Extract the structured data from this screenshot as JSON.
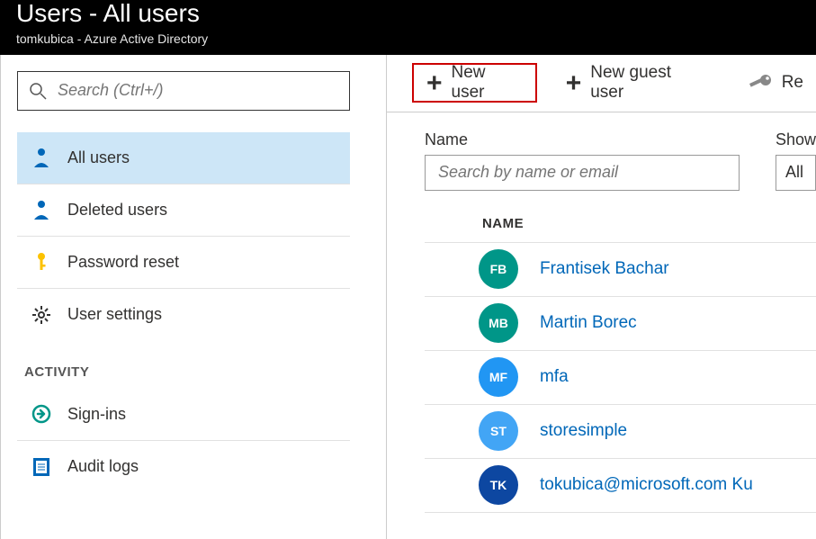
{
  "header": {
    "title": "Users - All users",
    "subtitle": "tomkubica - Azure Active Directory"
  },
  "search": {
    "placeholder": "Search (Ctrl+/)"
  },
  "sidebar": {
    "items": [
      {
        "label": "All users"
      },
      {
        "label": "Deleted users"
      },
      {
        "label": "Password reset"
      },
      {
        "label": "User settings"
      }
    ],
    "activity_heading": "ACTIVITY",
    "activity_items": [
      {
        "label": "Sign-ins"
      },
      {
        "label": "Audit logs"
      }
    ]
  },
  "toolbar": {
    "new_user": "New user",
    "new_guest_user": "New guest user",
    "reset": "Re"
  },
  "filters": {
    "name_label": "Name",
    "name_placeholder": "Search by name or email",
    "show_label": "Show",
    "show_value": "All"
  },
  "table": {
    "col_name": "NAME",
    "rows": [
      {
        "initials": "FB",
        "color": "#009688",
        "name": "Frantisek Bachar"
      },
      {
        "initials": "MB",
        "color": "#009688",
        "name": "Martin Borec"
      },
      {
        "initials": "MF",
        "color": "#2196F3",
        "name": "mfa"
      },
      {
        "initials": "ST",
        "color": "#42A5F5",
        "name": "storesimple"
      },
      {
        "initials": "TK",
        "color": "#0d47a1",
        "name": "tokubica@microsoft.com Ku"
      }
    ]
  }
}
